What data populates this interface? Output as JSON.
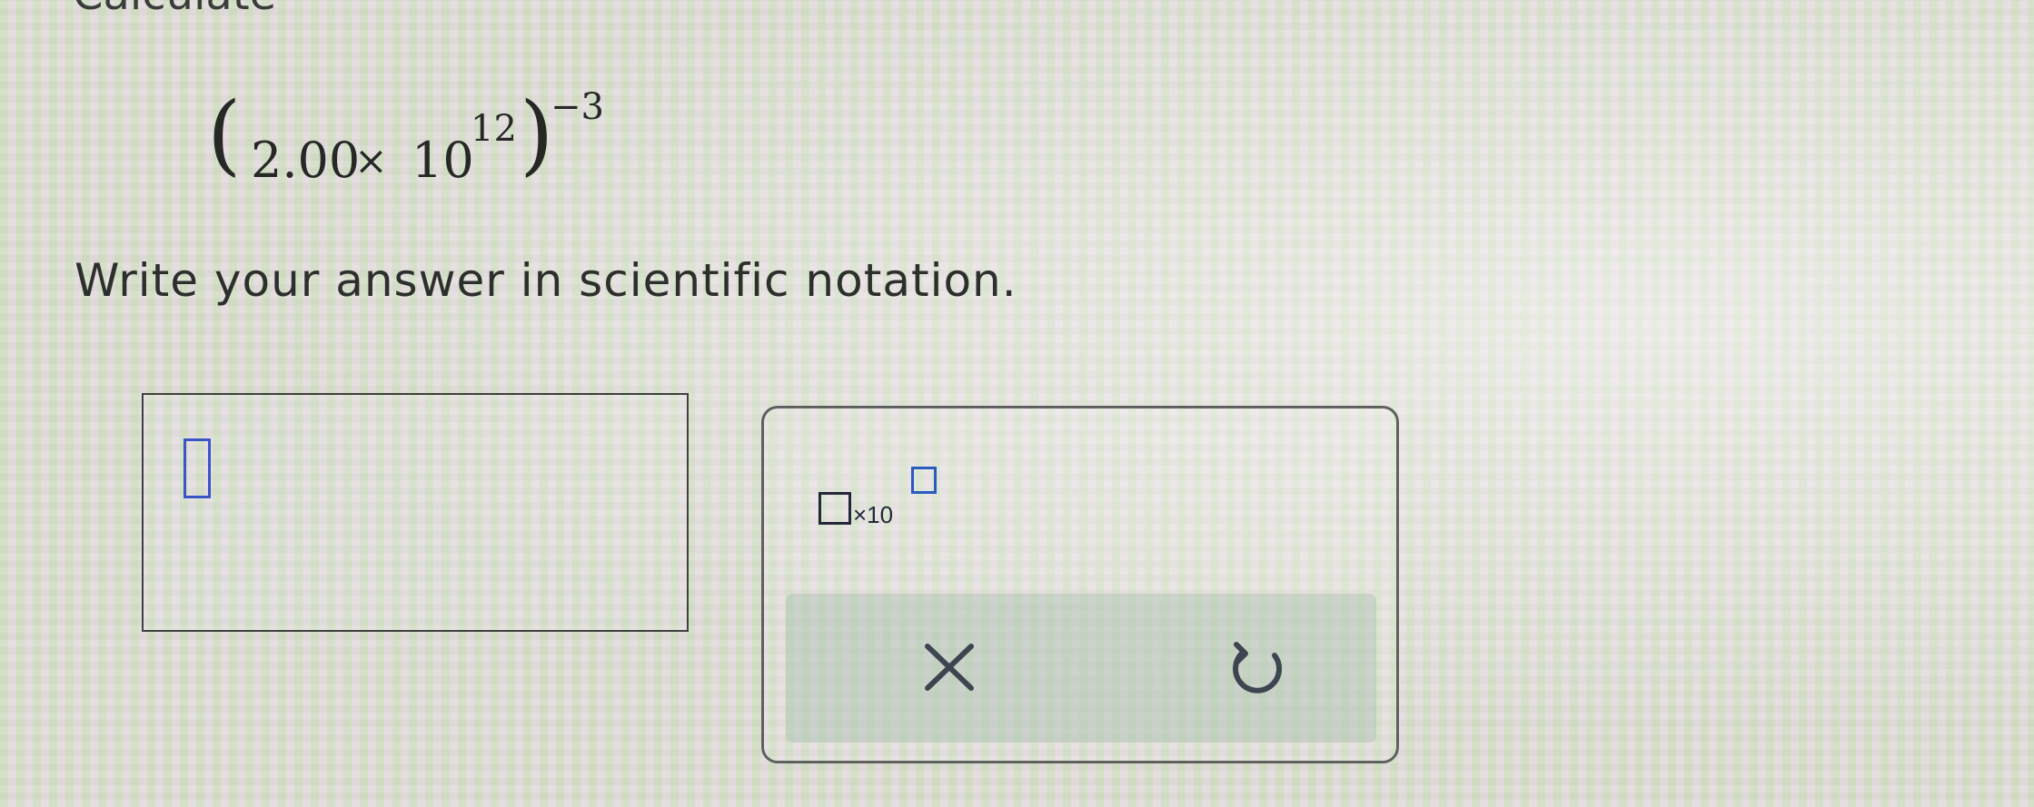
{
  "header": {
    "partial_title": "Calculate"
  },
  "expression": {
    "open_paren": "(",
    "mantissa": "2.00",
    "times": "×",
    "base": "10",
    "inner_exponent": "12",
    "close_paren": ")",
    "outer_exponent": "−3"
  },
  "instruction": "Write your answer in scientific notation.",
  "answer": {
    "value": ""
  },
  "keypad": {
    "sci_notation_label": "×10",
    "clear_icon": "x-icon",
    "undo_icon": "undo-icon",
    "colors": {
      "cursor": "#3b55c8",
      "exponent_box": "#2a5cc0",
      "icon": "#3d4550"
    }
  }
}
